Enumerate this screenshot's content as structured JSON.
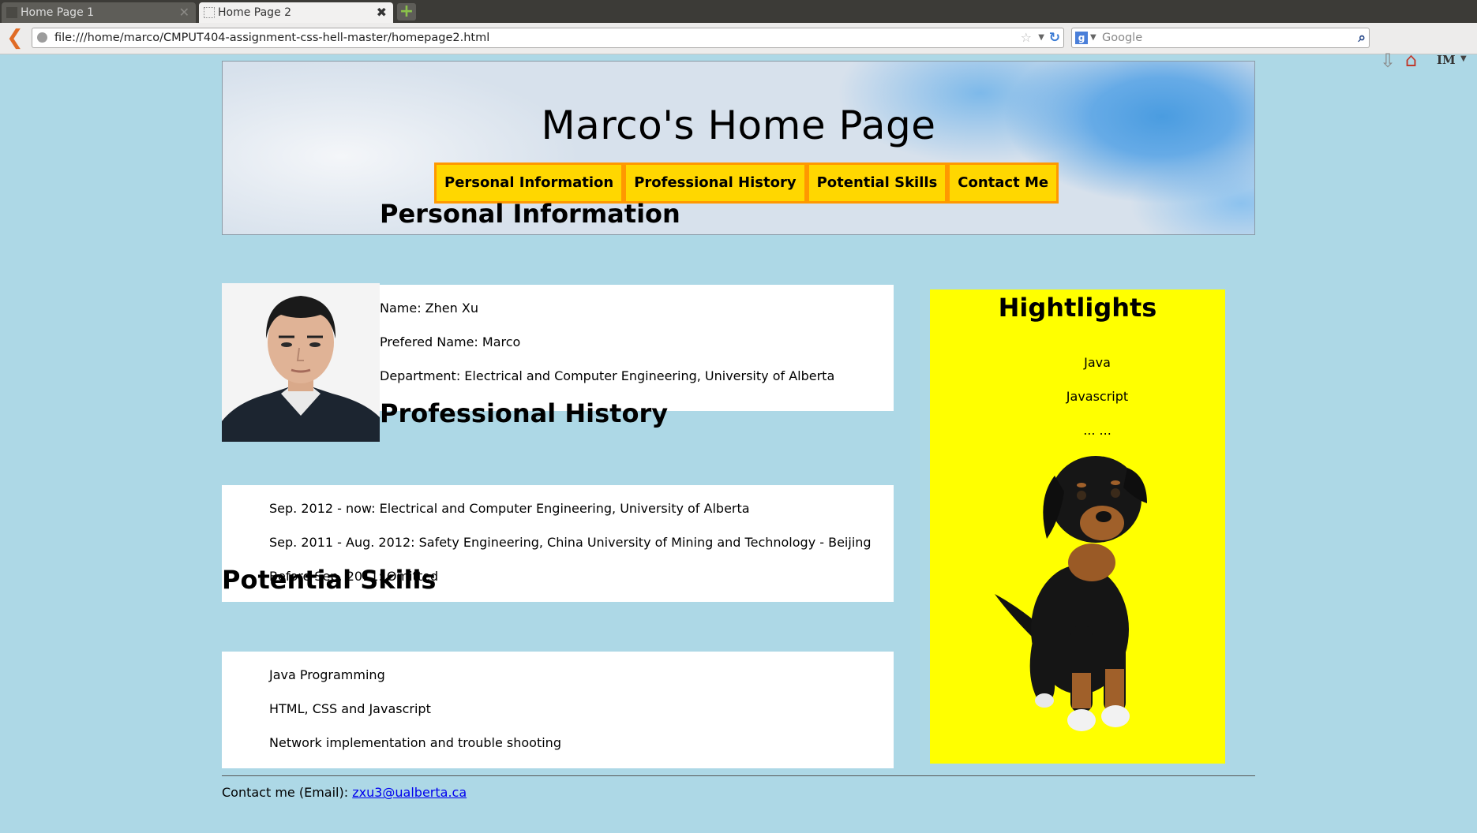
{
  "browser": {
    "tabs": [
      {
        "label": "Home Page 1",
        "active": false
      },
      {
        "label": "Home Page 2",
        "active": true
      }
    ],
    "url": "file:///home/marco/CMPUT404-assignment-css-hell-master/homepage2.html",
    "search_placeholder": "Google",
    "icons": [
      "back-icon",
      "star-icon",
      "reload-icon",
      "google-icon",
      "search-icon",
      "download-icon",
      "home-icon",
      "menu-icon"
    ],
    "addon_label": "IM"
  },
  "header": {
    "title": "Marco's Home Page",
    "nav": [
      "Personal Information",
      "Professional History",
      "Potential Skills",
      "Contact Me"
    ]
  },
  "personal": {
    "heading": "Personal Information",
    "lines": [
      "Name: Zhen Xu",
      "Prefered Name: Marco",
      "Department: Electrical and Computer Engineering, University of Alberta"
    ]
  },
  "history": {
    "heading": "Professional History",
    "lines": [
      "Sep. 2012 - now: Electrical and Computer Engineering, University of Alberta",
      "Sep. 2011 - Aug. 2012: Safety Engineering, China University of Mining and Technology - Beijing",
      "Before Sep. 2011: Omitted"
    ]
  },
  "skills": {
    "heading": "Potential Skills",
    "lines": [
      "Java Programming",
      "HTML, CSS and Javascript",
      "Network implementation and trouble shooting"
    ]
  },
  "highlights": {
    "title": "Hightlights",
    "items": [
      "Java",
      "Javascript",
      "... ..."
    ]
  },
  "footer": {
    "label": "Contact me (Email): ",
    "email": "zxu3@ualberta.ca"
  },
  "colors": {
    "page_bg": "#add8e6",
    "nav_bg": "#ffd700",
    "nav_border": "#ff9800",
    "highlights_bg": "#ffff00"
  }
}
